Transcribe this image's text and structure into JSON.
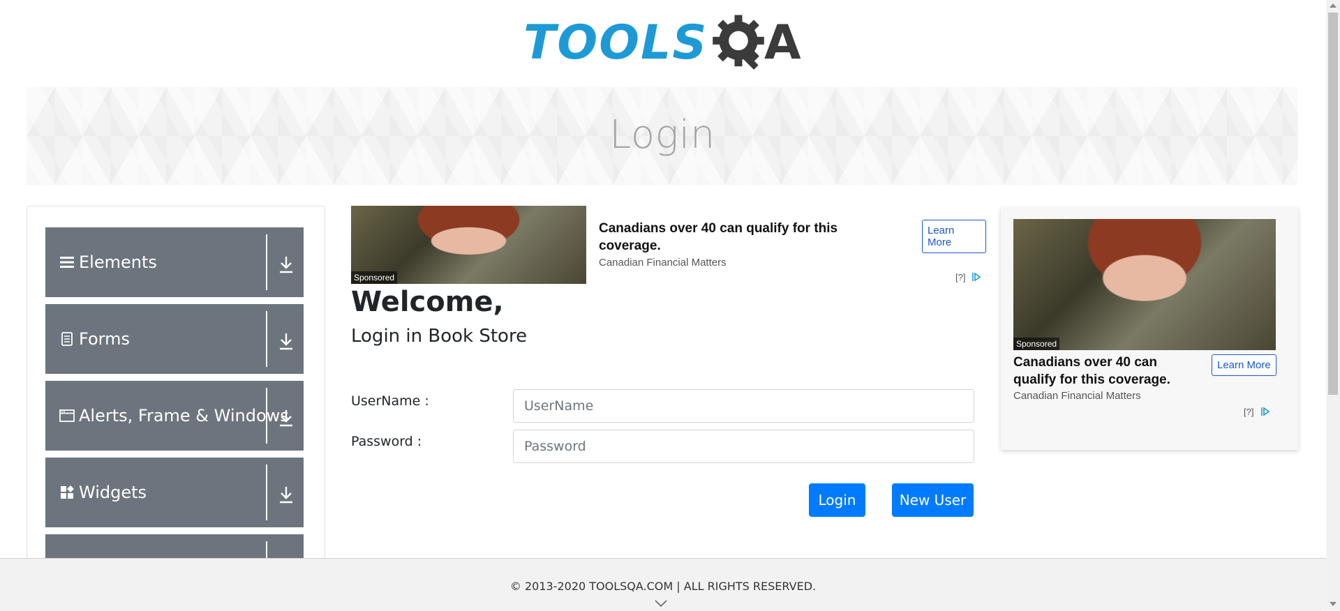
{
  "logo": {
    "text_blue": "TOOLS",
    "text_dark": "A",
    "alt_name": "TOOLSQA"
  },
  "banner": {
    "title": "Login"
  },
  "leftnav": {
    "groups": [
      {
        "label": "Elements",
        "icon": "hamburger-icon"
      },
      {
        "label": "Forms",
        "icon": "document-icon"
      },
      {
        "label": "Alerts, Frame & Windows",
        "icon": "window-icon"
      },
      {
        "label": "Widgets",
        "icon": "widgets-icon"
      },
      {
        "label": "",
        "icon": ""
      }
    ],
    "arrow_icon": "download-arrow-icon"
  },
  "ad_top": {
    "sponsored": "Sponsored",
    "headline": "Canadians over 40 can qualify for this coverage.",
    "advertiser": "Canadian Financial Matters",
    "cta": "Learn More",
    "info": "[?]"
  },
  "main": {
    "welcome": "Welcome,",
    "subtitle": "Login in Book Store",
    "username_label": "UserName :",
    "username_placeholder": "UserName",
    "username_value": "",
    "password_label": "Password :",
    "password_placeholder": "Password",
    "password_value": "",
    "login_button": "Login",
    "new_user_button": "New User"
  },
  "ad_right": {
    "sponsored": "Sponsored",
    "headline": "Canadians over 40 can qualify for this coverage.",
    "advertiser": "Canadian Financial Matters",
    "cta": "Learn More",
    "info": "[?]"
  },
  "footer": {
    "text": "© 2013-2020 TOOLSQA.COM | ALL RIGHTS RESERVED."
  },
  "colors": {
    "brand_blue": "#1d9ad6",
    "nav_gray": "#6c757d",
    "primary_button": "#007bff",
    "banner_title": "#a6a6a6"
  }
}
